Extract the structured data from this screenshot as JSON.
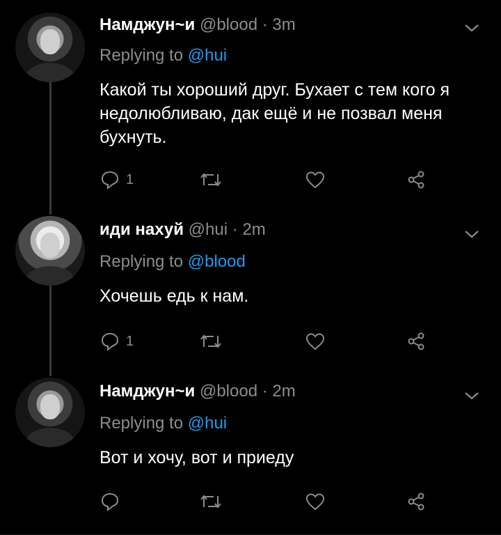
{
  "tweets": [
    {
      "name": "Намджун~и",
      "handle": "@blood",
      "separator": "·",
      "time": "3m",
      "replying_prefix": "Replying to ",
      "replying_to": "@hui",
      "text": "Какой ты хороший друг. Бухает с тем кого я недолюбливаю, дак ещё и не позвал меня бухнуть.",
      "reply_count": "1"
    },
    {
      "name": "иди нахуй",
      "handle": "@hui",
      "separator": "·",
      "time": "2m",
      "replying_prefix": "Replying to ",
      "replying_to": "@blood",
      "text": "Хочешь едь к нам.",
      "reply_count": "1"
    },
    {
      "name": "Намджун~и",
      "handle": "@blood",
      "separator": "·",
      "time": "2m",
      "replying_prefix": "Replying to ",
      "replying_to": "@hui",
      "text": "Вот и хочу, вот и приеду",
      "reply_count": ""
    }
  ],
  "icons": {
    "reply": "reply-icon",
    "retweet": "retweet-icon",
    "like": "heart-icon",
    "share": "share-icon",
    "menu": "chevron-down-icon"
  },
  "colors": {
    "background": "#000000",
    "muted": "#8a8d91",
    "mention": "#1d9bf0"
  }
}
